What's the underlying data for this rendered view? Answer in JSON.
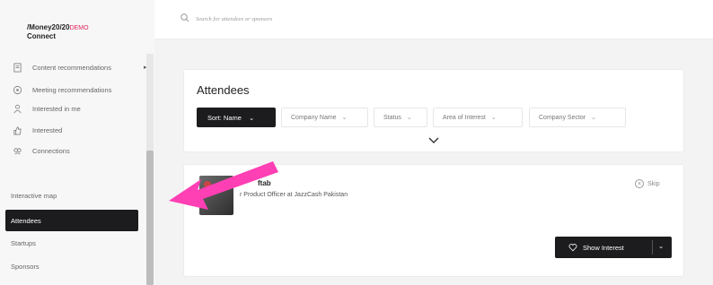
{
  "brand": {
    "logo_main": "/Money20/20",
    "logo_demo": "DEMO",
    "logo_sub": "Connect"
  },
  "search": {
    "placeholder": "Search for attendees or sponsors"
  },
  "sidebar": {
    "items": [
      {
        "label": "Content recommendations",
        "icon": "document-icon"
      },
      {
        "label": "Meeting recommendations",
        "icon": "target-icon"
      },
      {
        "label": "Interested in me",
        "icon": "person-icon"
      },
      {
        "label": "Interested",
        "icon": "thumbs-up-icon"
      },
      {
        "label": "Connections",
        "icon": "connections-icon"
      }
    ],
    "interactive_map": "Interactive map",
    "attendees": "Attendees",
    "startups": "Startups",
    "sponsors": "Sponsors"
  },
  "attendees": {
    "title": "Attendees",
    "sort_label": "Sort: Name",
    "filters": [
      "Company Name",
      "Status",
      "Area of Interest",
      "Company Sector"
    ]
  },
  "person": {
    "name": "ftab",
    "role": "r Product Officer at JazzCash Pakistan",
    "skip_label": "Skip",
    "show_interest_label": "Show Interest"
  },
  "colors": {
    "accent_dark": "#1c1c1e",
    "brand_pink": "#e0245e",
    "arrow_pink": "#ff3fb4"
  }
}
